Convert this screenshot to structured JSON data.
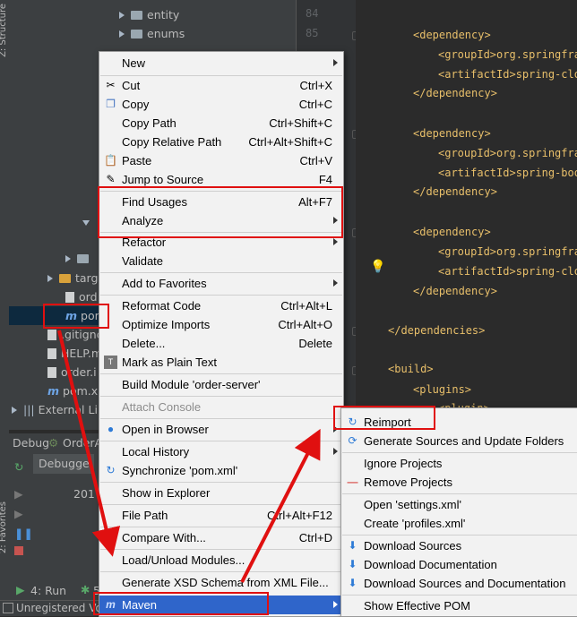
{
  "project_tree": {
    "items": [
      {
        "label": "entity",
        "kind": "folder",
        "expand": "collapsed"
      },
      {
        "label": "enums",
        "kind": "folder",
        "expand": "collapsed"
      },
      {
        "label": "targ",
        "kind": "folder-orange",
        "expand": "collapsed"
      },
      {
        "label": "ord",
        "kind": "file"
      },
      {
        "label": "pom",
        "kind": "maven"
      },
      {
        "label": ".gitignc",
        "kind": "file"
      },
      {
        "label": "HELP.m",
        "kind": "file"
      },
      {
        "label": "order.i",
        "kind": "file"
      },
      {
        "label": "pom.xm",
        "kind": "maven"
      },
      {
        "label": "External Li",
        "kind": "library",
        "expand": "collapsed"
      }
    ],
    "side_tab": "Z: Structure",
    "favorites_tab": "2: Favorites"
  },
  "gutter": {
    "line_numbers": [
      "84",
      "85"
    ]
  },
  "editor": {
    "lines": [
      {
        "text": "<dependency>",
        "indent": 1
      },
      {
        "text": "<groupId>org.springfra",
        "indent": 2
      },
      {
        "text": "<artifactId>spring-clo",
        "indent": 2
      },
      {
        "text": "</dependency>",
        "indent": 1
      },
      {
        "text": "<dependency>",
        "indent": 1
      },
      {
        "text": "<groupId>org.springfra",
        "indent": 2
      },
      {
        "text": "<artifactId>spring-boo",
        "indent": 2
      },
      {
        "text": "</dependency>",
        "indent": 1
      },
      {
        "text": "<dependency>",
        "indent": 1
      },
      {
        "text": "<groupId>org.springfra",
        "indent": 2
      },
      {
        "text": "<artifactId>spring-clo",
        "indent": 2
      },
      {
        "text": "</dependency>",
        "indent": 1
      },
      {
        "text": "</dependencies>",
        "indent": 0
      },
      {
        "text": "<build>",
        "indent": 0
      },
      {
        "text": "<plugins>",
        "indent": 1
      },
      {
        "text": "<plugin>",
        "indent": 2
      }
    ]
  },
  "debug": {
    "tab_label": "Debug",
    "config_label": "OrderA",
    "debugger_tab": "Debugge",
    "log_fragment": "201"
  },
  "bottom_bar": {
    "run_label": "4: Run",
    "debug_label": "5"
  },
  "status_bar": {
    "text": "Unregistered Vo"
  },
  "context_menu": {
    "items": [
      {
        "label": "New",
        "shortcut": "",
        "submenu": true
      },
      {
        "label": "Cut",
        "shortcut": "Ctrl+X",
        "icon": "scissors-icon"
      },
      {
        "label": "Copy",
        "shortcut": "Ctrl+C",
        "icon": "copy-icon"
      },
      {
        "label": "Copy Path",
        "shortcut": "Ctrl+Shift+C"
      },
      {
        "label": "Copy Relative Path",
        "shortcut": "Ctrl+Alt+Shift+C"
      },
      {
        "label": "Paste",
        "shortcut": "Ctrl+V",
        "icon": "paste-icon"
      },
      {
        "label": "Jump to Source",
        "shortcut": "F4",
        "icon": "jump-icon"
      },
      {
        "label": "Find Usages",
        "shortcut": "Alt+F7"
      },
      {
        "label": "Analyze",
        "shortcut": "",
        "submenu": true
      },
      {
        "label": "Refactor",
        "shortcut": "",
        "submenu": true
      },
      {
        "label": "Validate",
        "shortcut": ""
      },
      {
        "label": "Add to Favorites",
        "shortcut": "",
        "submenu": true
      },
      {
        "label": "Reformat Code",
        "shortcut": "Ctrl+Alt+L"
      },
      {
        "label": "Optimize Imports",
        "shortcut": "Ctrl+Alt+O"
      },
      {
        "label": "Delete...",
        "shortcut": "Delete"
      },
      {
        "label": "Mark as Plain Text",
        "shortcut": "",
        "icon": "plain-text-icon"
      },
      {
        "label": "Build Module 'order-server'",
        "shortcut": ""
      },
      {
        "label": "Attach Console",
        "shortcut": "",
        "disabled": true
      },
      {
        "label": "Open in Browser",
        "shortcut": "",
        "submenu": true,
        "icon": "globe-icon"
      },
      {
        "label": "Local History",
        "shortcut": "",
        "submenu": true
      },
      {
        "label": "Synchronize 'pom.xml'",
        "shortcut": "",
        "icon": "sync-icon"
      },
      {
        "label": "Show in Explorer",
        "shortcut": ""
      },
      {
        "label": "File Path",
        "shortcut": "Ctrl+Alt+F12"
      },
      {
        "label": "Compare With...",
        "shortcut": "Ctrl+D",
        "icon": "compare-icon"
      },
      {
        "label": "Load/Unload Modules...",
        "shortcut": ""
      },
      {
        "label": "Generate XSD Schema from XML File...",
        "shortcut": ""
      },
      {
        "label": "Maven",
        "shortcut": "",
        "submenu": true,
        "selected": true,
        "icon": "maven-icon"
      }
    ]
  },
  "maven_submenu": {
    "items": [
      {
        "label": "Reimport",
        "icon": "reimport-icon"
      },
      {
        "label": "Generate Sources and Update Folders",
        "icon": "generate-sources-icon"
      },
      {
        "label": "Ignore Projects"
      },
      {
        "label": "Remove Projects",
        "icon": "minus-icon"
      },
      {
        "label": "Open 'settings.xml'"
      },
      {
        "label": "Create 'profiles.xml'"
      },
      {
        "label": "Download Sources",
        "icon": "download-icon"
      },
      {
        "label": "Download Documentation",
        "icon": "download-icon"
      },
      {
        "label": "Download Sources and Documentation",
        "icon": "download-icon"
      },
      {
        "label": "Show Effective POM"
      }
    ]
  },
  "colors": {
    "annotation": "#e01010",
    "selection": "#2f65ca",
    "maven_icon": "#3d8fdc"
  }
}
